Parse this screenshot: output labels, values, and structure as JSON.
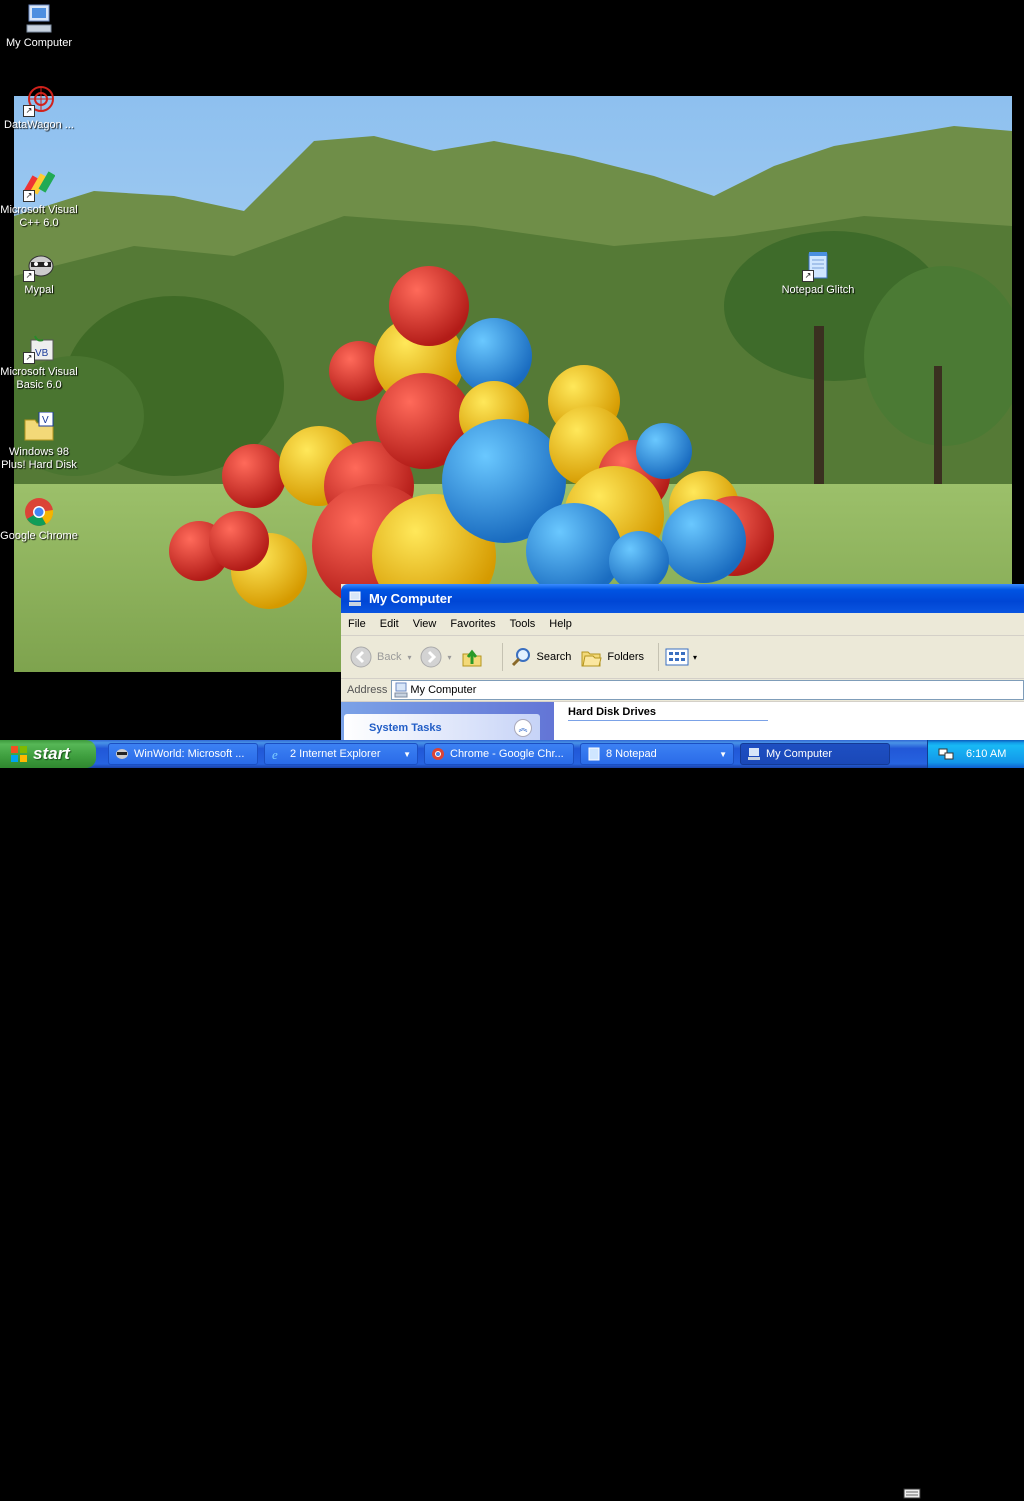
{
  "desktop": {
    "icons": [
      {
        "label": "My Computer",
        "icon": "computer-icon"
      },
      {
        "label": "DataWagon ...",
        "icon": "datawagon-icon"
      },
      {
        "label": "Microsoft Visual C++ 6.0",
        "icon": "visual-cpp-icon"
      },
      {
        "label": "Mypal",
        "icon": "mypal-icon"
      },
      {
        "label": "Microsoft Visual Basic 6.0",
        "icon": "visual-basic-icon"
      },
      {
        "label": "Windows 98 Plus! Hard Disk",
        "icon": "folder-icon"
      },
      {
        "label": "Google Chrome",
        "icon": "chrome-icon"
      },
      {
        "label": "Notepad Glitch",
        "icon": "notepad-icon"
      }
    ]
  },
  "window": {
    "title": "My Computer",
    "menu": [
      "File",
      "Edit",
      "View",
      "Favorites",
      "Tools",
      "Help"
    ],
    "toolbar": {
      "back": "Back",
      "search": "Search",
      "folders": "Folders"
    },
    "address_label": "Address",
    "address_value": "My Computer",
    "task_pane_title": "System Tasks",
    "section_title": "Hard Disk Drives"
  },
  "taskbar": {
    "start_label": "start",
    "buttons": [
      {
        "label": "WinWorld: Microsoft ...",
        "icon": "mypal-icon"
      },
      {
        "label": "2 Internet Explorer",
        "icon": "ie-icon"
      },
      {
        "label": "Chrome - Google Chr...",
        "icon": "chrome-icon"
      },
      {
        "label": "8 Notepad",
        "icon": "notepad-icon"
      },
      {
        "label": "My Computer",
        "icon": "computer-icon"
      }
    ],
    "clock": "6:10 AM"
  },
  "colors": {
    "xp_blue": "#0054e3",
    "start_green": "#3e9e3e",
    "tray_blue": "#139ee9"
  }
}
